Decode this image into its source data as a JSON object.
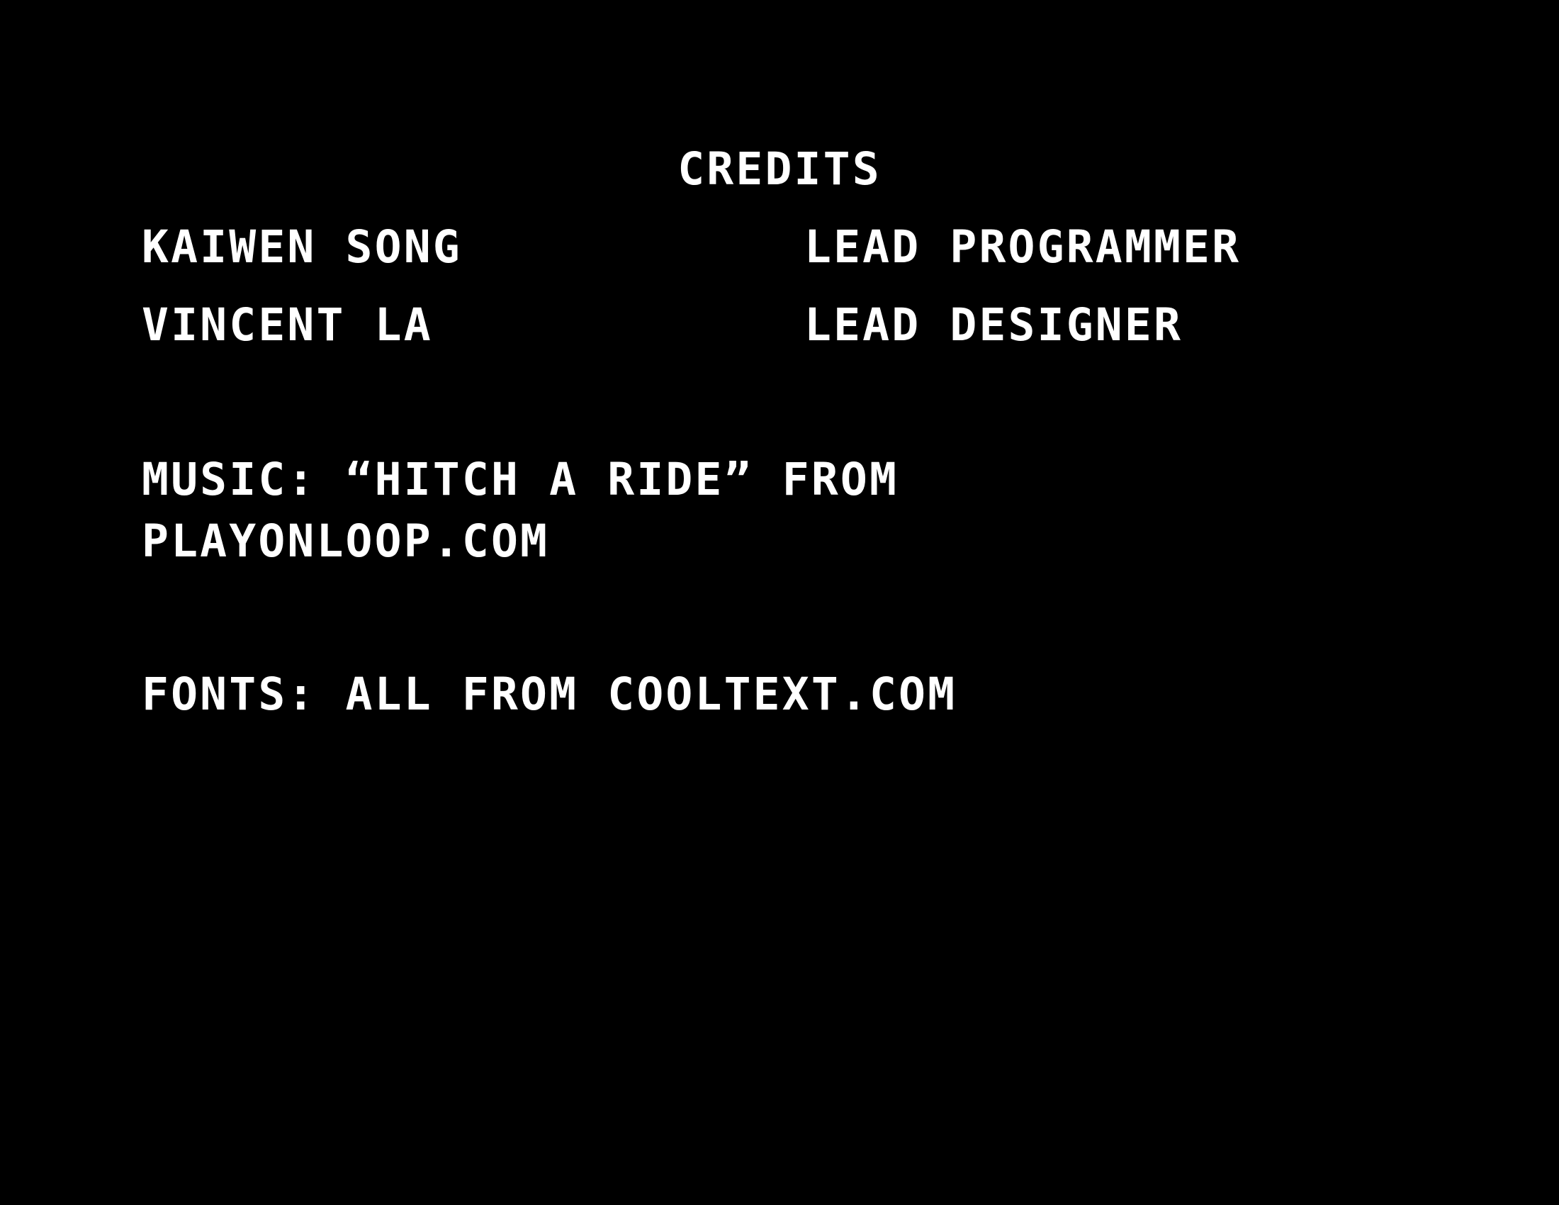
{
  "screen": {
    "title": "CREDITS",
    "credits": [
      {
        "name": "KAIWEN SONG",
        "role": "LEAD PROGRAMMER"
      },
      {
        "name": "VINCENT LA",
        "role": "LEAD DESIGNER"
      }
    ],
    "music_line_1": "MUSIC: “HITCH A RIDE” FROM",
    "music_line_2": "PLAYONLOOP.COM",
    "fonts_line": "FONTS: ALL FROM COOLTEXT.COM"
  },
  "colors": {
    "background": "#000000",
    "text": "#ffffff"
  }
}
